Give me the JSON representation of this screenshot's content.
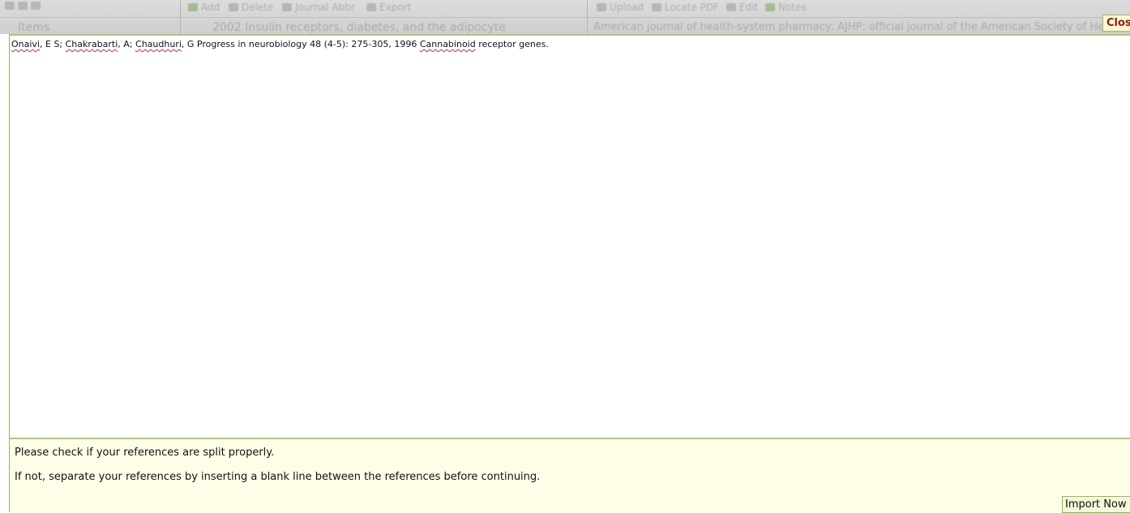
{
  "background_app": {
    "toolbar_left": [
      "Add",
      "Delete",
      "Journal Abbr",
      "Export"
    ],
    "toolbar_right": [
      "Upload",
      "Locate PDF",
      "Edit",
      "Notes"
    ],
    "items_label": "Items",
    "row_text_left": "2002 Insulin receptors, diabetes, and the adipocyte",
    "row_text_right": "American journal of health-system pharmacy: AJHP: official journal of the American Society of Health-System"
  },
  "modal": {
    "close_label": "Close",
    "reference_parts": [
      {
        "text": "Onaivi",
        "spell": true
      },
      {
        "text": ", E S; ",
        "spell": false
      },
      {
        "text": "Chakrabarti",
        "spell": true
      },
      {
        "text": ", A; ",
        "spell": false
      },
      {
        "text": "Chaudhuri",
        "spell": true
      },
      {
        "text": ", G Progress in neurobiology 48 (4-5): 275-305, 1996 ",
        "spell": false
      },
      {
        "text": "Cannabinoid",
        "spell": true
      },
      {
        "text": " receptor genes.",
        "spell": false
      }
    ],
    "info_line_1": "Please check if your references are split properly.",
    "info_line_2": "If not, separate your references by inserting a blank line between the references before continuing.",
    "import_label": "Import Now"
  },
  "colors": {
    "accent_border": "#a8cc7c",
    "info_background": "#fefee8",
    "close_text": "#8b1a1a"
  }
}
